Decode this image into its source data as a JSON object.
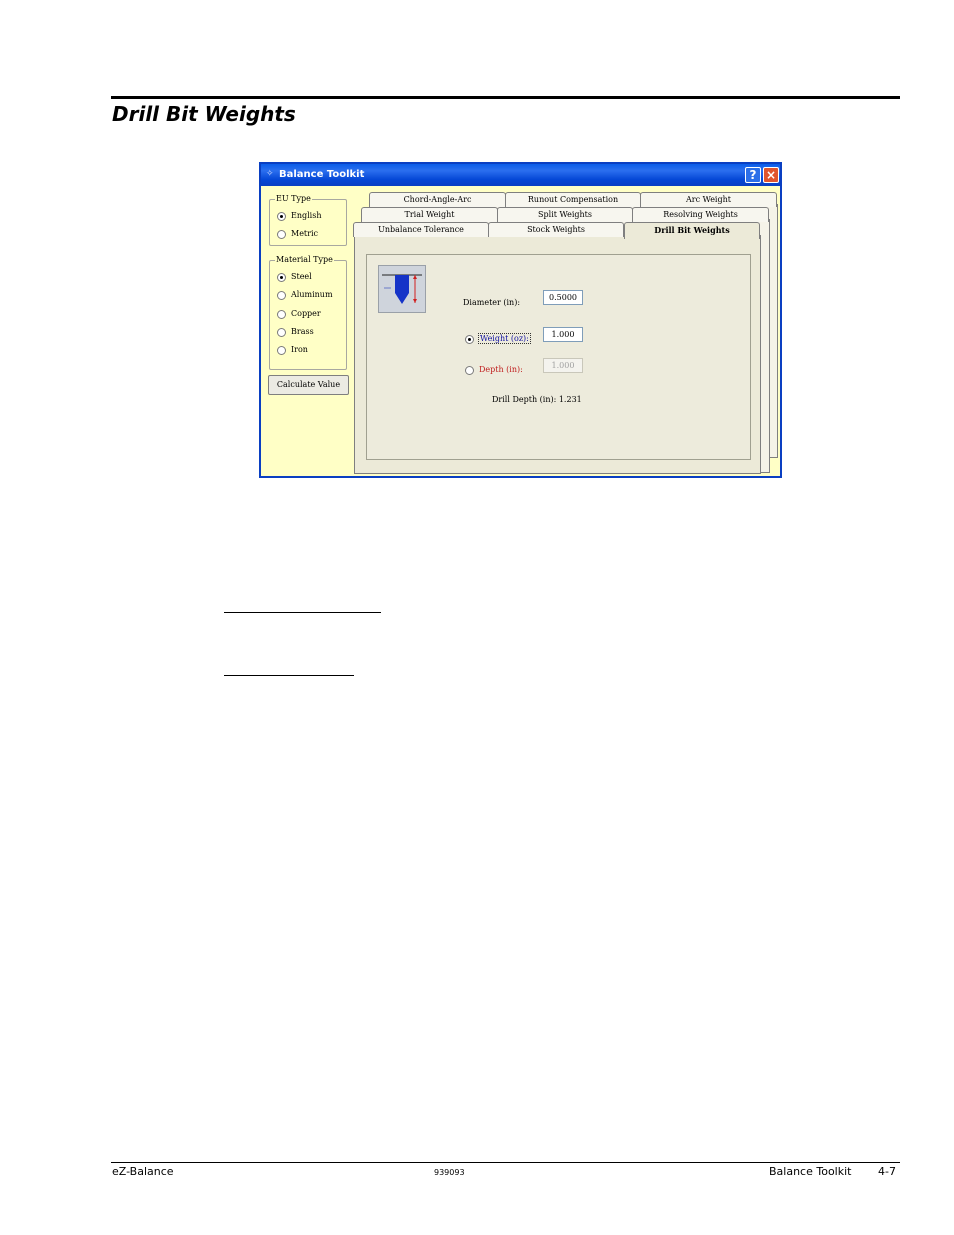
{
  "document": {
    "section_title": "Drill Bit Weights"
  },
  "dialog": {
    "title": "Balance Toolkit",
    "help_button": "?",
    "close_button": "×",
    "eu_type": {
      "legend": "EU Type",
      "options": [
        "English",
        "Metric"
      ],
      "selected": "English"
    },
    "material_type": {
      "legend": "Material Type",
      "options": [
        "Steel",
        "Aluminum",
        "Copper",
        "Brass",
        "Iron"
      ],
      "selected": "Steel"
    },
    "calculate_button": "Calculate Value",
    "tabs": {
      "row1": [
        "Chord-Angle-Arc",
        "Runout Compensation",
        "Arc Weight"
      ],
      "row2": [
        "Trial  Weight",
        "Split Weights",
        "Resolving Weights"
      ],
      "row3": [
        "Unbalance Tolerance",
        "Stock Weights",
        "Drill Bit Weights"
      ],
      "active": "Drill Bit Weights"
    },
    "drill_bit": {
      "image_name": "drill-bit-diagram",
      "diameter_label": "Diameter  (in):",
      "diameter_value": "0.5000",
      "weight_label": "Weight  (oz):",
      "weight_value": "1.000",
      "weight_selected": true,
      "depth_label": "Depth  (in):",
      "depth_value": "1.000",
      "depth_selected": false,
      "result_label": "Drill Depth  (in):",
      "result_value": "1.231"
    }
  },
  "footer": {
    "left": "eZ-Balance",
    "center": "939093",
    "section": "Balance Toolkit",
    "page": "4-7"
  },
  "colors": {
    "titlebar": "#0a5de8",
    "window_body": "#ffffc6",
    "weight_label": "#1010a0",
    "depth_label": "#c02020"
  }
}
